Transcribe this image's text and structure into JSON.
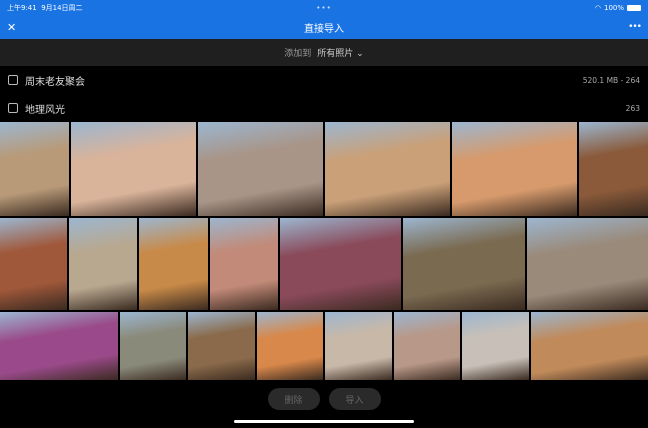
{
  "status": {
    "time": "上午9:41",
    "date": "9月14日周二",
    "battery": "100%"
  },
  "header": {
    "title": "直接导入",
    "close_icon": "close-icon",
    "more_icon": "more-icon"
  },
  "add_to": {
    "label": "添加到",
    "album": "所有照片"
  },
  "groups": [
    {
      "name": "周末老友聚会",
      "meta": "520.1 MB - 264"
    },
    {
      "name": "地理风光",
      "meta": "263"
    }
  ],
  "photos": {
    "row1": [
      "#b89a78",
      "#d9b39a",
      "#a89588",
      "#c9a078",
      "#d69a6c",
      "#8a5a3a"
    ],
    "row2": [
      "#a0583a",
      "#b8a890",
      "#c88a48",
      "#c28a78",
      "#8a4a5a",
      "#7a6a50",
      "#9a8a7a"
    ],
    "row3": [
      "#9a4a8a",
      "#8a8a7a",
      "#8a6a4a",
      "#d8884a",
      "#c8b8a8",
      "#b89888",
      "#c8c0b8",
      "#c08a5a"
    ]
  },
  "actions": {
    "delete": "删除",
    "import": "导入"
  }
}
